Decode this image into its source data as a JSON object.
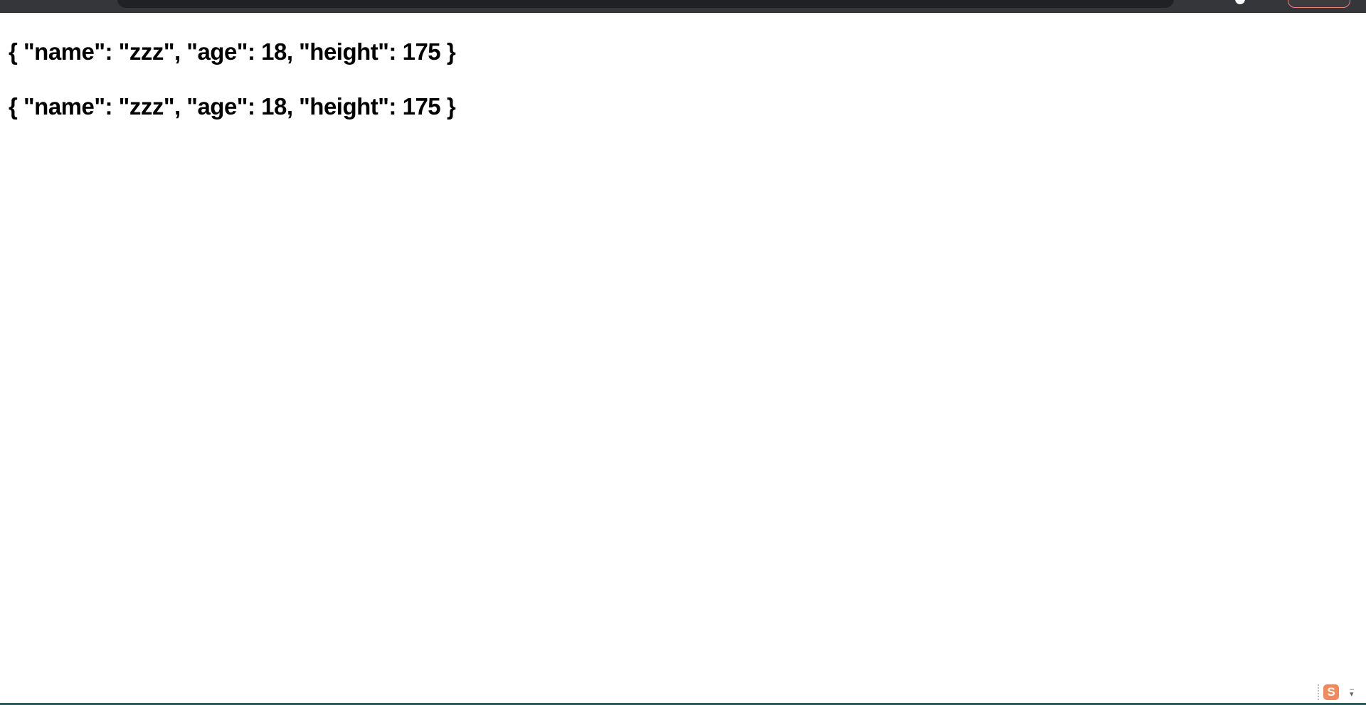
{
  "page": {
    "lines": [
      "{ \"name\": \"zzz\", \"age\": 18, \"height\": 175 }",
      "{ \"name\": \"zzz\", \"age\": 18, \"height\": 175 }"
    ]
  },
  "taskbar": {
    "ime_icon": "sogou-input-icon",
    "ime_label": "S",
    "accent": "#f08a5d"
  }
}
